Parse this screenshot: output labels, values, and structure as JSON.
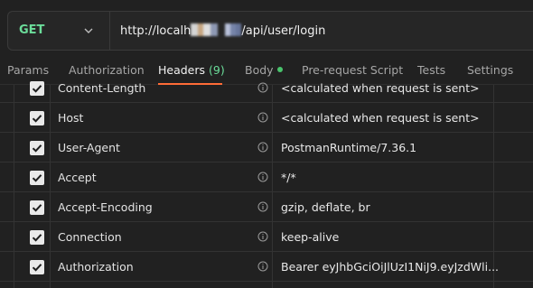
{
  "request": {
    "method": "GET",
    "url_prefix": "http://localh",
    "url_suffix": "/api/user/login"
  },
  "tabs": [
    {
      "label": "Params"
    },
    {
      "label": "Authorization"
    },
    {
      "label": "Headers",
      "count": "(9)"
    },
    {
      "label": "Body"
    },
    {
      "label": "Pre-request Script"
    },
    {
      "label": "Tests"
    },
    {
      "label": "Settings"
    }
  ],
  "headers": [
    {
      "key": "Content-Length",
      "value": "<calculated when request is sent>",
      "checked": true
    },
    {
      "key": "Host",
      "value": "<calculated when request is sent>",
      "checked": true
    },
    {
      "key": "User-Agent",
      "value": "PostmanRuntime/7.36.1",
      "checked": true
    },
    {
      "key": "Accept",
      "value": "*/*",
      "checked": true
    },
    {
      "key": "Accept-Encoding",
      "value": "gzip, deflate, br",
      "checked": true
    },
    {
      "key": "Connection",
      "value": "keep-alive",
      "checked": true
    },
    {
      "key": "Authorization",
      "value": "Bearer eyJhbGciOiJlUzI1NiJ9.eyJzdWli...",
      "checked": true
    }
  ],
  "icons": {
    "method_dropdown": "chevron-down-icon",
    "row_info": "info-icon",
    "checkbox": "checkmark-icon",
    "body_indicator": "status-dot"
  },
  "colors": {
    "method": "#6bdd9a",
    "active_tab_underline": "#ff6c37",
    "headers_count": "#6bdd9a",
    "body_dot": "#49c46c"
  }
}
